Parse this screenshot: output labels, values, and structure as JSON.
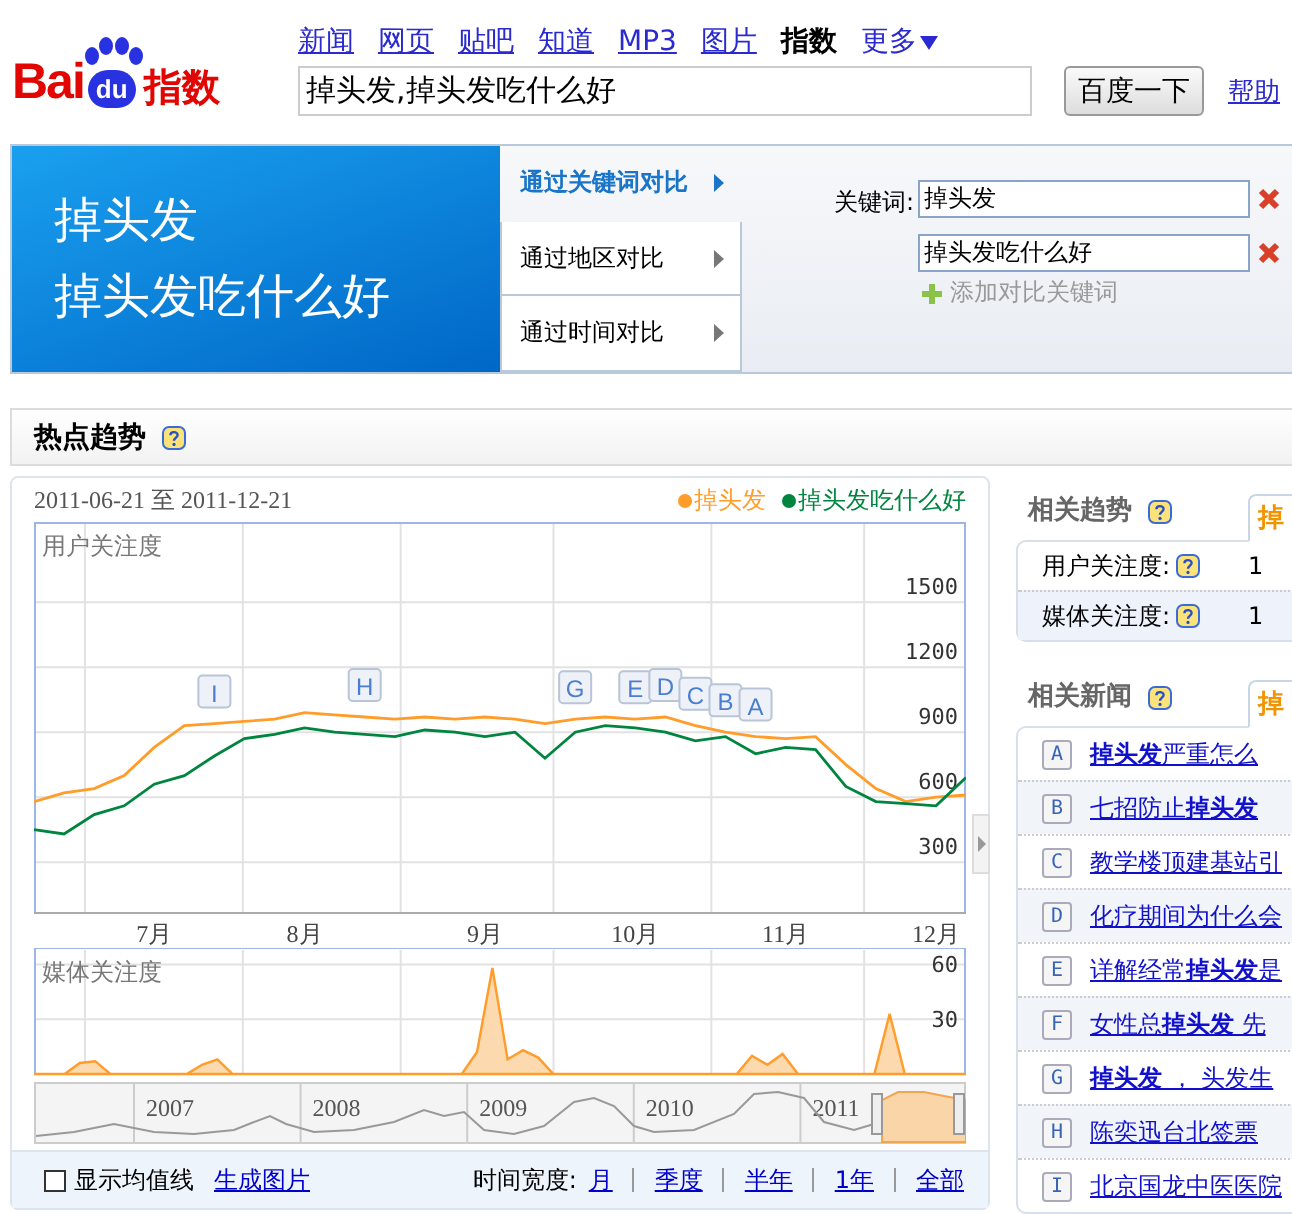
{
  "logo": {
    "text": "Bai",
    "badge": "du",
    "suffix": "指数"
  },
  "nav": [
    {
      "label": "新闻",
      "selected": false,
      "kind": "link"
    },
    {
      "label": "网页",
      "selected": false,
      "kind": "link"
    },
    {
      "label": "贴吧",
      "selected": false,
      "kind": "link"
    },
    {
      "label": "知道",
      "selected": false,
      "kind": "link"
    },
    {
      "label": "MP3",
      "selected": false,
      "kind": "link"
    },
    {
      "label": "图片",
      "selected": false,
      "kind": "link"
    },
    {
      "label": "指数",
      "selected": true,
      "kind": "link"
    },
    {
      "label": "更多",
      "selected": false,
      "kind": "menu"
    }
  ],
  "search": {
    "value": "掉头发,掉头发吃什么好",
    "button": "百度一下",
    "help": "帮助"
  },
  "banner": {
    "titles": [
      "掉头发",
      "掉头发吃什么好"
    ],
    "modes": [
      {
        "label": "通过关键词对比",
        "selected": true
      },
      {
        "label": "通过地区对比",
        "selected": false
      },
      {
        "label": "通过时间对比",
        "selected": false
      }
    ],
    "keyword_label": "关键词:",
    "keywords": [
      "掉头发",
      "掉头发吃什么好"
    ],
    "add_label": "添加对比关键词"
  },
  "hot_trend": {
    "title": "热点趋势",
    "date_range": "2011-06-21 至 2011-12-21",
    "user_chart": {
      "chart_data": {
        "type": "line",
        "title": "用户关注度",
        "categories": [
          null,
          null,
          null,
          null,
          "7月",
          null,
          null,
          null,
          null,
          "8月",
          null,
          null,
          null,
          null,
          null,
          "9月",
          null,
          null,
          null,
          null,
          "10月",
          null,
          null,
          null,
          null,
          "11月",
          null,
          null,
          null,
          null,
          "12月",
          null
        ],
        "series": [
          {
            "name": "掉头发",
            "color": "#ff9c2a",
            "values": [
              580,
              620,
              640,
              700,
              830,
              930,
              940,
              950,
              960,
              990,
              980,
              970,
              960,
              970,
              960,
              970,
              960,
              940,
              960,
              970,
              960,
              970,
              930,
              900,
              880,
              870,
              880,
              750,
              640,
              580,
              600,
              610
            ]
          },
          {
            "name": "掉头发吃什么好",
            "color": "#00853f",
            "values": [
              450,
              430,
              520,
              560,
              660,
              700,
              790,
              870,
              890,
              920,
              900,
              890,
              880,
              910,
              900,
              880,
              900,
              780,
              900,
              930,
              920,
              900,
              860,
              880,
              800,
              830,
              820,
              650,
              580,
              570,
              560,
              690
            ]
          }
        ],
        "ylim": [
          70,
          1870
        ],
        "grid": true,
        "yticks": [
          300,
          600,
          900,
          1200,
          1500
        ],
        "annotations": [
          "I",
          "H",
          "G",
          "E",
          "D",
          "C",
          "B",
          "A"
        ]
      }
    },
    "media_chart": {
      "chart_data": {
        "type": "area",
        "title": "媒体关注度",
        "grid": true,
        "categories": [
          null,
          null,
          null,
          null,
          null,
          null,
          null,
          null,
          null,
          null,
          null,
          null,
          null,
          null,
          null,
          null,
          null,
          null,
          null,
          null,
          null,
          null,
          null,
          null,
          null,
          null,
          null,
          null,
          null,
          null,
          null,
          null,
          null,
          null,
          null,
          null,
          null,
          null,
          null,
          null,
          null,
          null,
          null,
          null,
          null,
          null,
          null,
          null,
          null,
          null,
          null,
          null,
          null,
          null,
          null,
          null,
          null,
          null,
          null,
          null,
          null,
          null
        ],
        "series": [
          {
            "color": "#ff9c2a",
            "values": [
              0,
              0,
              0,
              6,
              7,
              0,
              0,
              0,
              0,
              0,
              0,
              5,
              8,
              0,
              0,
              0,
              0,
              0,
              0,
              0,
              0,
              0,
              0,
              0,
              0,
              0,
              0,
              0,
              0,
              12,
              58,
              8,
              13,
              9,
              0,
              0,
              0,
              0,
              0,
              0,
              0,
              0,
              0,
              0,
              0,
              0,
              0,
              10,
              5,
              11,
              0,
              0,
              0,
              0,
              0,
              0,
              33,
              0,
              0,
              0,
              0,
              0
            ]
          }
        ],
        "ylim": [
          0,
          69
        ],
        "yticks": [
          30,
          60
        ]
      }
    },
    "overview_years": [
      "2007",
      "2008",
      "2009",
      "2010",
      "2011"
    ],
    "show_average": {
      "label": "显示均值线",
      "checked": false
    },
    "generate_image": "生成图片",
    "time_width": {
      "label": "时间宽度:",
      "options": [
        "月",
        "季度",
        "半年",
        "1年",
        "全部"
      ]
    }
  },
  "related_trends": {
    "title": "相关趋势",
    "tab": "掉",
    "rows": [
      {
        "label": "用户关注度:",
        "value": "1"
      },
      {
        "label": "媒体关注度:",
        "value": "1"
      }
    ]
  },
  "related_news": {
    "title": "相关新闻",
    "tab": "掉",
    "items": [
      {
        "letter": "A",
        "title": "**掉头发**严重怎么"
      },
      {
        "letter": "B",
        "title": "七招防止**掉头发**"
      },
      {
        "letter": "C",
        "title": "教学楼顶建基站引"
      },
      {
        "letter": "D",
        "title": "化疗期间为什么会"
      },
      {
        "letter": "E",
        "title": "详解经常**掉头发**是"
      },
      {
        "letter": "F",
        "title": "女性总**掉头发** 先"
      },
      {
        "letter": "G",
        "title": "**掉头发** ， 头发生"
      },
      {
        "letter": "H",
        "title": "陈奕迅台北签票"
      },
      {
        "letter": "I",
        "title": "北京国龙中医医院"
      }
    ]
  }
}
